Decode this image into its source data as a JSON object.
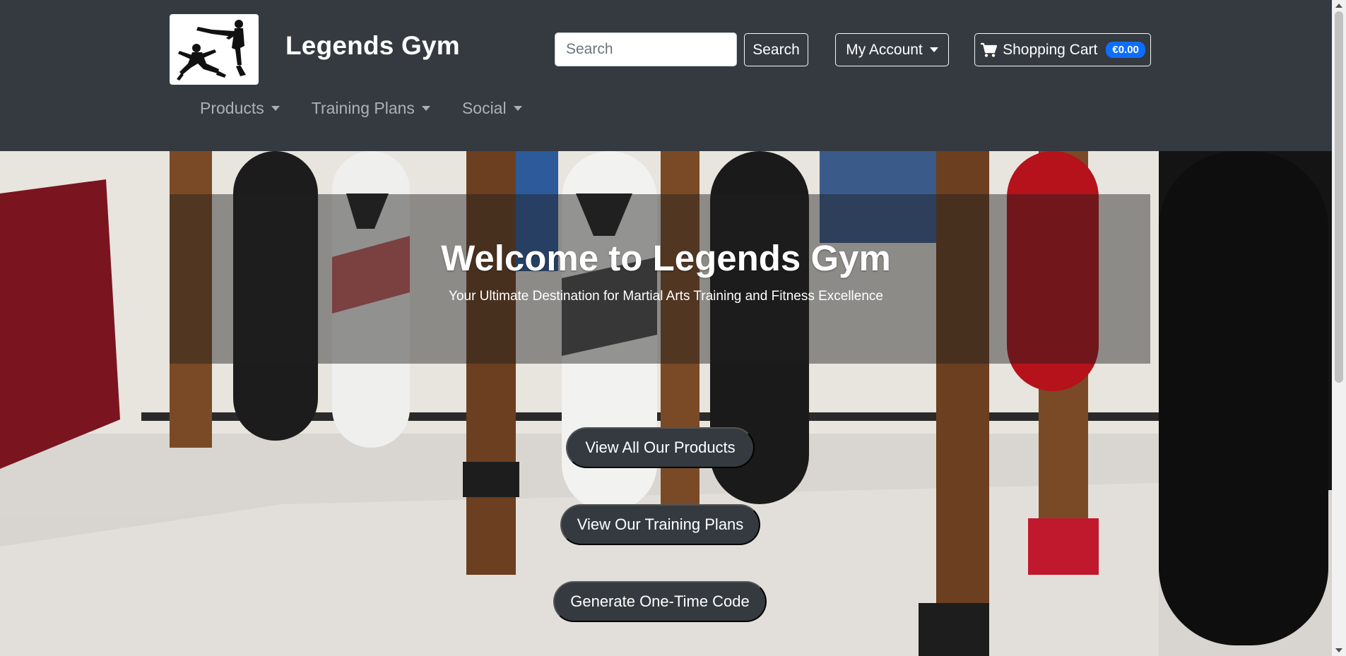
{
  "header": {
    "brand": "Legends Gym",
    "logo_icon": "martial-arts-silhouette-logo",
    "search": {
      "placeholder": "Search",
      "button_label": "Search"
    },
    "account_label": "My Account",
    "cart": {
      "label": "Shopping Cart",
      "total": "€0.00",
      "icon": "cart-icon"
    }
  },
  "nav": {
    "items": [
      {
        "label": "Products"
      },
      {
        "label": "Training Plans"
      },
      {
        "label": "Social"
      }
    ]
  },
  "hero": {
    "title": "Welcome to Legends Gym",
    "subtitle": "Your Ultimate Destination for Martial Arts Training and Fitness Excellence",
    "buttons": [
      {
        "label": "View All Our Products"
      },
      {
        "label": "View Our Training Plans"
      },
      {
        "label": "Generate One-Time Code"
      }
    ]
  },
  "colors": {
    "header_bg": "#343a40",
    "badge": "#0d6efd",
    "pill_bg": "#343a40"
  }
}
